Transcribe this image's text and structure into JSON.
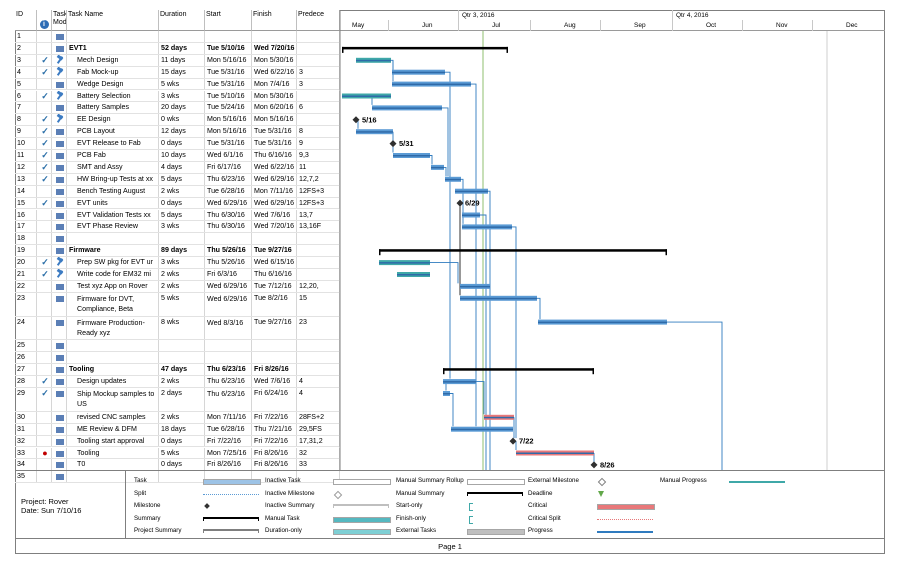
{
  "headers": {
    "id": "ID",
    "indicators_icon": "info-icon",
    "mode": "Task Mode",
    "name": "Task Name",
    "duration": "Duration",
    "start": "Start",
    "finish": "Finish",
    "predecessors": "Predece"
  },
  "timescale": {
    "quarters": [
      "Qtr 3, 2016",
      "Qtr 4, 2016"
    ],
    "months": [
      "May",
      "Jun",
      "Jul",
      "Aug",
      "Sep",
      "Oct",
      "Nov",
      "Dec"
    ]
  },
  "rows": [
    {
      "id": "1",
      "ind": "",
      "mode": "manual",
      "name": "",
      "dur": "",
      "start": "",
      "fin": "",
      "pred": ""
    },
    {
      "id": "2",
      "ind": "",
      "mode": "auto",
      "name": "EVT1",
      "dur": "52 days",
      "start": "Tue 5/10/16",
      "fin": "Wed 7/20/16",
      "pred": "",
      "bold": true
    },
    {
      "id": "3",
      "ind": "check",
      "mode": "pin",
      "name": "Mech Design",
      "dur": "11 days",
      "start": "Mon 5/16/16",
      "fin": "Mon 5/30/16",
      "pred": ""
    },
    {
      "id": "4",
      "ind": "check",
      "mode": "pin",
      "name": "Fab Mock-up",
      "dur": "15 days",
      "start": "Tue 5/31/16",
      "fin": "Wed 6/22/16",
      "pred": "3"
    },
    {
      "id": "5",
      "ind": "",
      "mode": "auto",
      "name": "Wedge Design",
      "dur": "5 wks",
      "start": "Tue 5/31/16",
      "fin": "Mon 7/4/16",
      "pred": "3"
    },
    {
      "id": "6",
      "ind": "check",
      "mode": "pin",
      "name": "Battery Selection",
      "dur": "3 wks",
      "start": "Tue 5/10/16",
      "fin": "Mon 5/30/16",
      "pred": ""
    },
    {
      "id": "7",
      "ind": "",
      "mode": "auto",
      "name": "Battery Samples",
      "dur": "20 days",
      "start": "Tue 5/24/16",
      "fin": "Mon 6/20/16",
      "pred": "6"
    },
    {
      "id": "8",
      "ind": "check",
      "mode": "pin",
      "name": "EE Design",
      "dur": "0 wks",
      "start": "Mon 5/16/16",
      "fin": "Mon 5/16/16",
      "pred": ""
    },
    {
      "id": "9",
      "ind": "check",
      "mode": "auto",
      "name": "PCB Layout",
      "dur": "12 days",
      "start": "Mon 5/16/16",
      "fin": "Tue 5/31/16",
      "pred": "8"
    },
    {
      "id": "10",
      "ind": "check",
      "mode": "auto",
      "name": "EVT Release to Fab",
      "dur": "0 days",
      "start": "Tue 5/31/16",
      "fin": "Tue 5/31/16",
      "pred": "9"
    },
    {
      "id": "11",
      "ind": "check",
      "mode": "auto",
      "name": "PCB Fab",
      "dur": "10 days",
      "start": "Wed 6/1/16",
      "fin": "Thu 6/16/16",
      "pred": "9,3"
    },
    {
      "id": "12",
      "ind": "check",
      "mode": "auto",
      "name": "SMT and Assy",
      "dur": "4 days",
      "start": "Fri 6/17/16",
      "fin": "Wed 6/22/16",
      "pred": "11"
    },
    {
      "id": "13",
      "ind": "check",
      "mode": "auto",
      "name": "HW Bring-up Tests at xx",
      "dur": "5 days",
      "start": "Thu 6/23/16",
      "fin": "Wed 6/29/16",
      "pred": "12,7,2"
    },
    {
      "id": "14",
      "ind": "",
      "mode": "auto",
      "name": "Bench Testing August",
      "dur": "2 wks",
      "start": "Tue 6/28/16",
      "fin": "Mon 7/11/16",
      "pred": "12FS+3"
    },
    {
      "id": "15",
      "ind": "check",
      "mode": "auto",
      "name": "EVT units",
      "dur": "0 days",
      "start": "Wed 6/29/16",
      "fin": "Wed 6/29/16",
      "pred": "12FS+3"
    },
    {
      "id": "16",
      "ind": "",
      "mode": "auto",
      "name": "EVT Validation Tests xx",
      "dur": "5 days",
      "start": "Thu 6/30/16",
      "fin": "Wed 7/6/16",
      "pred": "13,7"
    },
    {
      "id": "17",
      "ind": "",
      "mode": "auto",
      "name": "EVT Phase Review",
      "dur": "3 wks",
      "start": "Thu 6/30/16",
      "fin": "Wed 7/20/16",
      "pred": "13,16F"
    },
    {
      "id": "18",
      "ind": "",
      "mode": "manual",
      "name": "",
      "dur": "",
      "start": "",
      "fin": "",
      "pred": ""
    },
    {
      "id": "19",
      "ind": "",
      "mode": "auto",
      "name": "Firmware",
      "dur": "89 days",
      "start": "Thu 5/26/16",
      "fin": "Tue 9/27/16",
      "pred": "",
      "bold": true
    },
    {
      "id": "20",
      "ind": "check",
      "mode": "pin",
      "name": "Prep SW pkg for EVT ur",
      "dur": "3 wks",
      "start": "Thu 5/26/16",
      "fin": "Wed 6/15/16",
      "pred": ""
    },
    {
      "id": "21",
      "ind": "check",
      "mode": "pin",
      "name": "Write code for EM32 mi",
      "dur": "2 wks",
      "start": "Fri 6/3/16",
      "fin": "Thu 6/16/16",
      "pred": ""
    },
    {
      "id": "22",
      "ind": "",
      "mode": "auto",
      "name": "Test xyz App on Rover",
      "dur": "2 wks",
      "start": "Wed 6/29/16",
      "fin": "Tue 7/12/16",
      "pred": "12,20,"
    },
    {
      "id": "23",
      "ind": "",
      "mode": "auto",
      "name": "Firmware for DVT, Compliance, Beta",
      "dur": "5 wks",
      "start": "Wed 6/29/16",
      "fin": "Tue 8/2/16",
      "pred": "15",
      "tall": true
    },
    {
      "id": "24",
      "ind": "",
      "mode": "auto",
      "name": "Firmware Production-Ready xyz",
      "dur": "8 wks",
      "start": "Wed 8/3/16",
      "fin": "Tue 9/27/16",
      "pred": "23",
      "tall": true
    },
    {
      "id": "25",
      "ind": "",
      "mode": "manual",
      "name": "",
      "dur": "",
      "start": "",
      "fin": "",
      "pred": ""
    },
    {
      "id": "26",
      "ind": "",
      "mode": "manual",
      "name": "",
      "dur": "",
      "start": "",
      "fin": "",
      "pred": ""
    },
    {
      "id": "27",
      "ind": "",
      "mode": "auto",
      "name": "Tooling",
      "dur": "47 days",
      "start": "Thu 6/23/16",
      "fin": "Fri 8/26/16",
      "pred": "",
      "bold": true
    },
    {
      "id": "28",
      "ind": "check",
      "mode": "auto",
      "name": "Design updates",
      "dur": "2 wks",
      "start": "Thu 6/23/16",
      "fin": "Wed 7/6/16",
      "pred": "4"
    },
    {
      "id": "29",
      "ind": "check",
      "mode": "auto",
      "name": "Ship Mockup samples to US",
      "dur": "2 days",
      "start": "Thu 6/23/16",
      "fin": "Fri 6/24/16",
      "pred": "4",
      "tall": true
    },
    {
      "id": "30",
      "ind": "",
      "mode": "auto",
      "name": "revised CNC samples",
      "dur": "2 wks",
      "start": "Mon 7/11/16",
      "fin": "Fri 7/22/16",
      "pred": "28FS+2"
    },
    {
      "id": "31",
      "ind": "",
      "mode": "auto",
      "name": "ME Review & DFM",
      "dur": "18 days",
      "start": "Tue 6/28/16",
      "fin": "Thu 7/21/16",
      "pred": "29,5FS"
    },
    {
      "id": "32",
      "ind": "",
      "mode": "auto",
      "name": "Tooling start approval",
      "dur": "0 days",
      "start": "Fri 7/22/16",
      "fin": "Fri 7/22/16",
      "pred": "17,31,2"
    },
    {
      "id": "33",
      "ind": "red",
      "mode": "auto",
      "name": "Tooling",
      "dur": "5 wks",
      "start": "Mon 7/25/16",
      "fin": "Fri 8/26/16",
      "pred": "32"
    },
    {
      "id": "34",
      "ind": "",
      "mode": "auto",
      "name": "T0",
      "dur": "0 days",
      "start": "Fri 8/26/16",
      "fin": "Fri 8/26/16",
      "pred": "33"
    },
    {
      "id": "35",
      "ind": "",
      "mode": "manual",
      "name": "",
      "dur": "",
      "start": "",
      "fin": "",
      "pred": ""
    }
  ],
  "milestone_labels": [
    "5/16",
    "5/31",
    "6/29",
    "7/22",
    "8/26"
  ],
  "legend": {
    "project_name": "Project: Rover",
    "date": "Date: Sun 7/10/16",
    "items": [
      "Task",
      "Split",
      "Milestone",
      "Summary",
      "Project Summary",
      "Inactive Task",
      "Inactive Milestone",
      "Inactive Summary",
      "Manual Task",
      "Duration-only",
      "Manual Summary Rollup",
      "Manual Summary",
      "Start-only",
      "Finish-only",
      "External Tasks",
      "External Milestone",
      "Deadline",
      "Critical",
      "Critical Split",
      "Progress",
      "Manual Progress"
    ]
  },
  "footer": {
    "page": "Page 1"
  },
  "colors": {
    "task": "#5b9bd5",
    "manual_task": "#3fa8a8",
    "critical": "#e8787a",
    "summary": "#000000",
    "link": "#2f7bbf"
  }
}
